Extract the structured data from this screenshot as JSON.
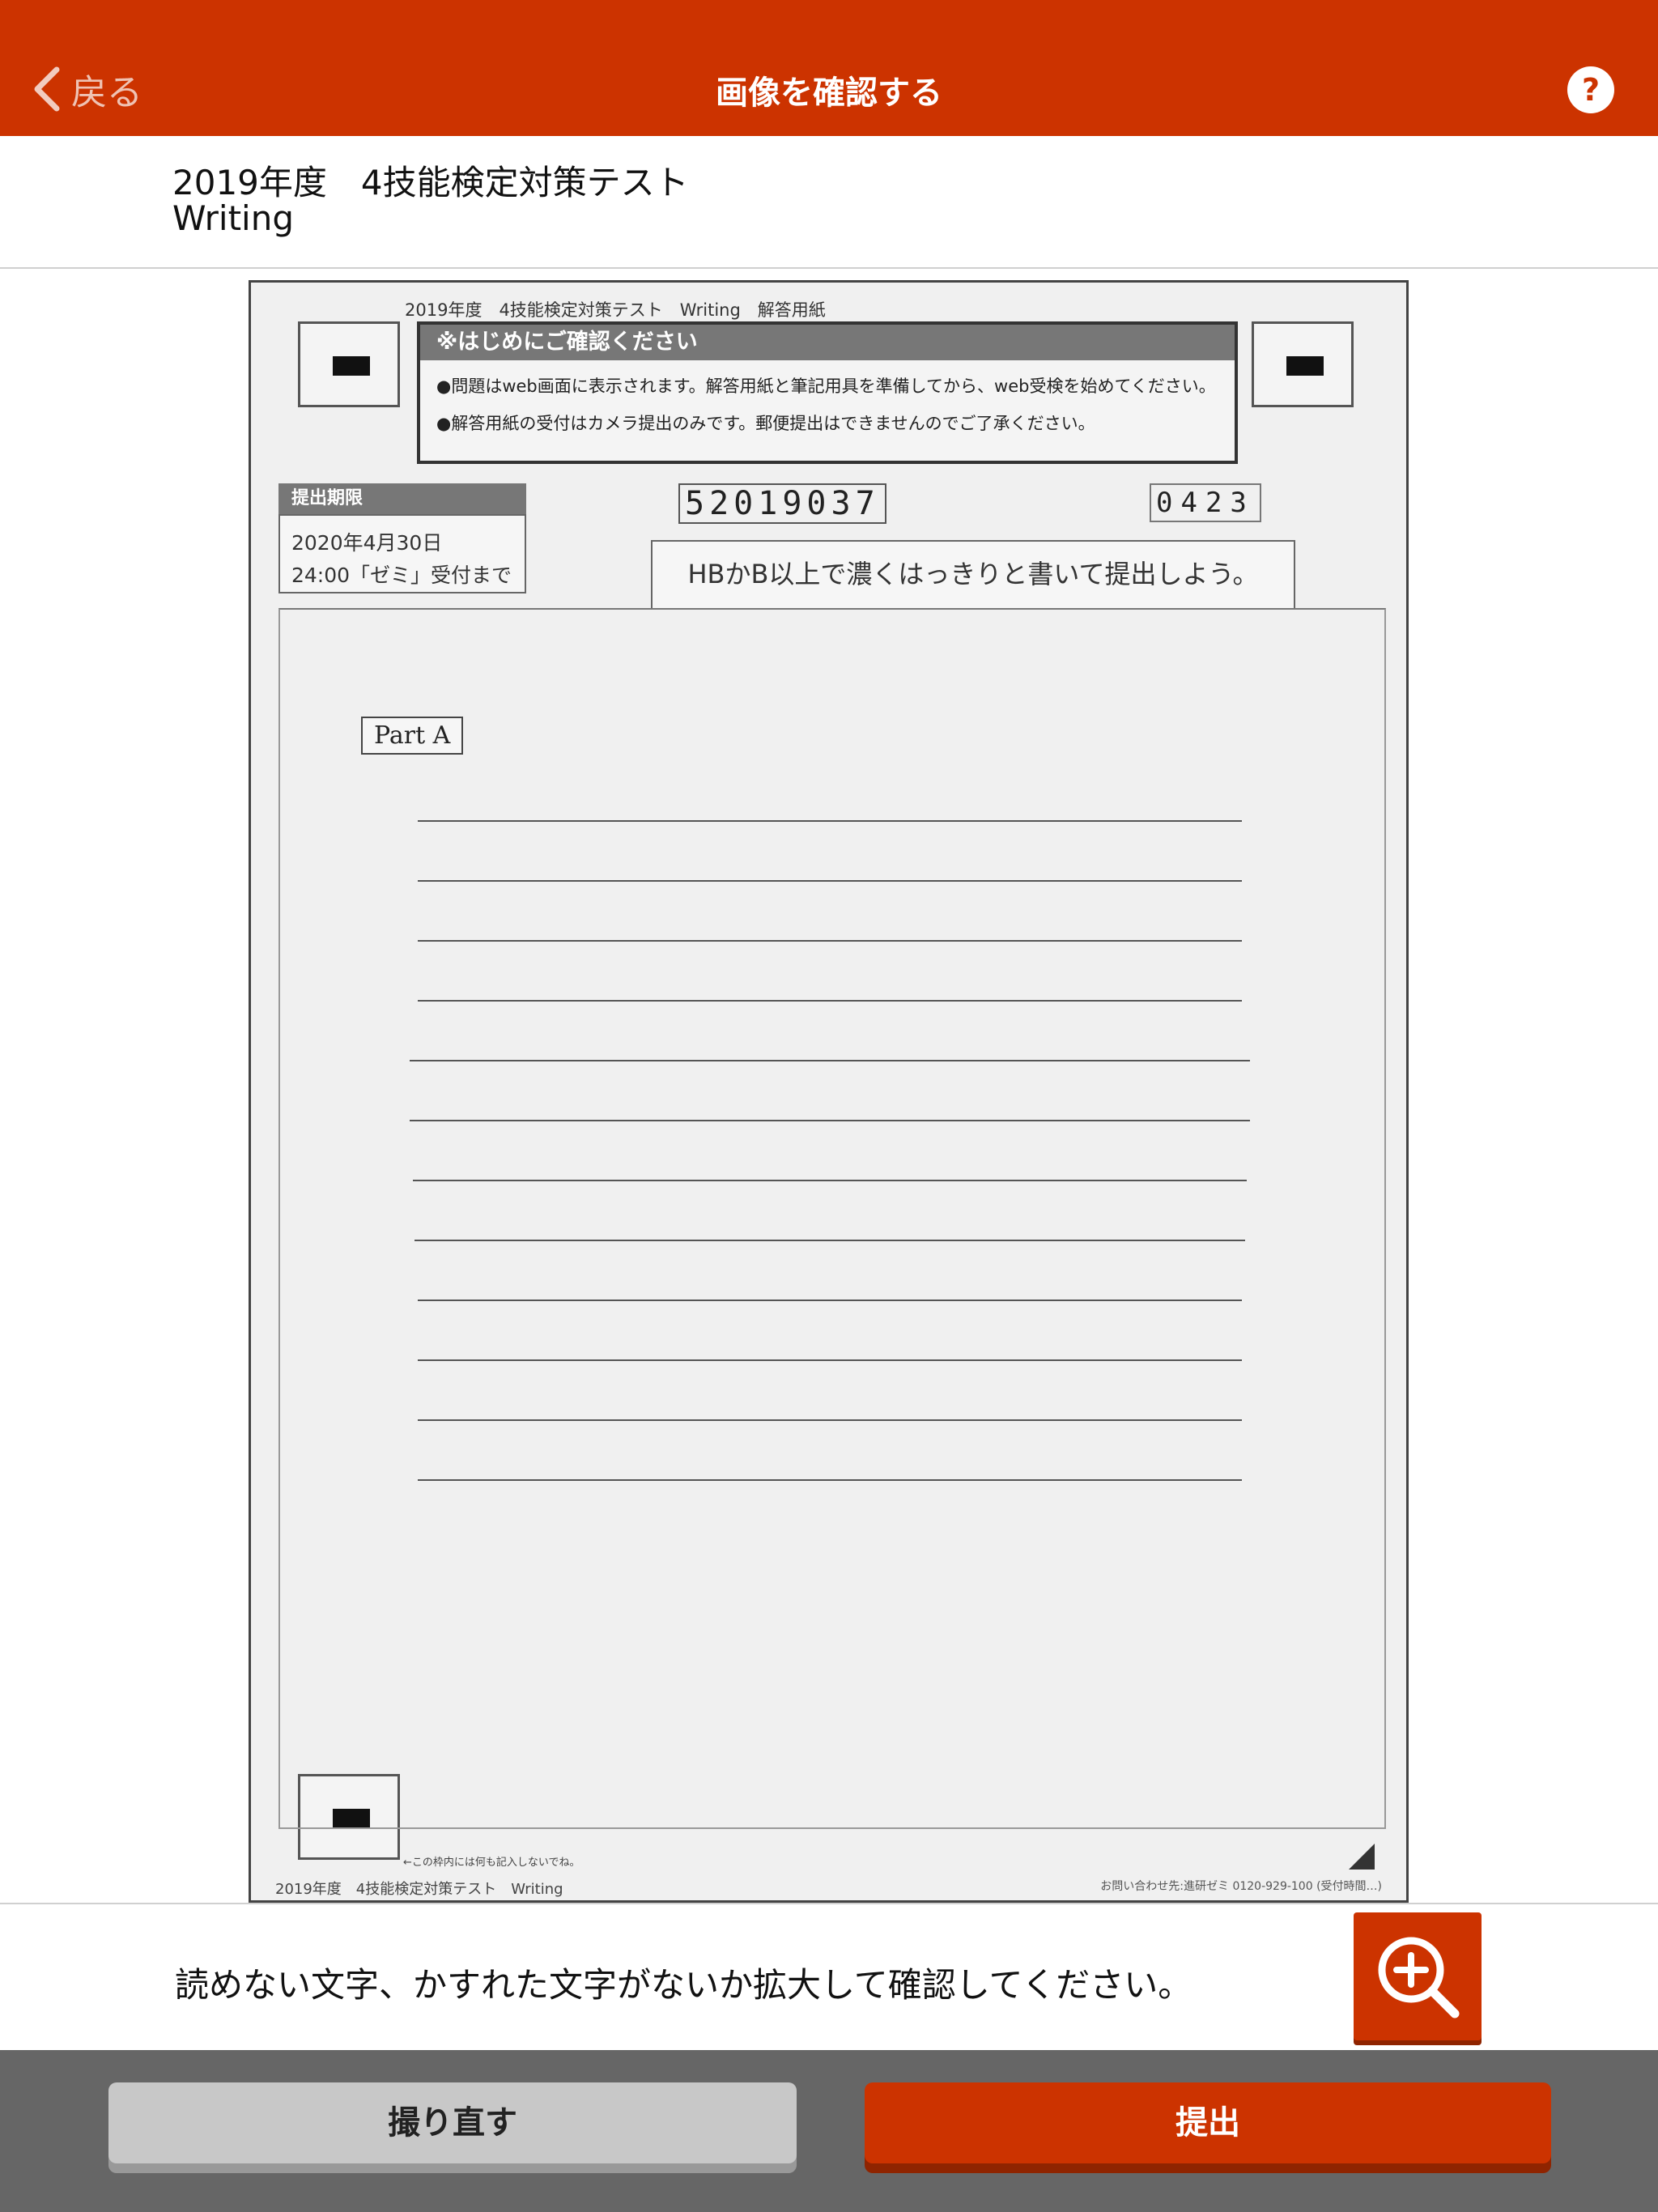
{
  "navbar": {
    "back_label": "戻る",
    "title": "画像を確認する",
    "help_label": "?"
  },
  "subheader": {
    "title_line1": "2019年度　4技能検定対策テスト",
    "title_line2": "Writing"
  },
  "sheet": {
    "header": "2019年度　4技能検定対策テスト　Writing　解答用紙",
    "notice_title": "※はじめにご確認ください",
    "notice_line1": "●問題はweb画面に表示されます。解答用紙と筆記用具を準備してから、web受検を始めてください。",
    "notice_line2": "●解答用紙の受付はカメラ提出のみです。郵便提出はできませんのでご了承ください。",
    "deadline_title": "提出期限",
    "deadline_line1": "2020年4月30日",
    "deadline_line2": "24:00「ゼミ」受付まで",
    "student_id": "52019037",
    "code_id": "0423",
    "pencil_note": "HBかB以上で濃くはっきりと書いて提出しよう。",
    "part_label": "Part A",
    "corner_note": "←この枠内には何も記入しないでね。",
    "footer_left": "2019年度　4技能検定対策テスト　Writing",
    "footer_right": "お問い合わせ先:進研ゼミ 0120-929-100 (受付時間…)"
  },
  "instruction": {
    "text": "読めない文字、かすれた文字がないか拡大して確認してください。"
  },
  "buttons": {
    "retake": "撮り直す",
    "submit": "提出"
  },
  "colors": {
    "brand": "#cc3300",
    "bottom_bar": "#666666",
    "retake_bg": "#c8c8c8"
  },
  "icons": {
    "back": "chevron-left-icon",
    "help": "question-icon",
    "zoom": "zoom-in-icon"
  }
}
